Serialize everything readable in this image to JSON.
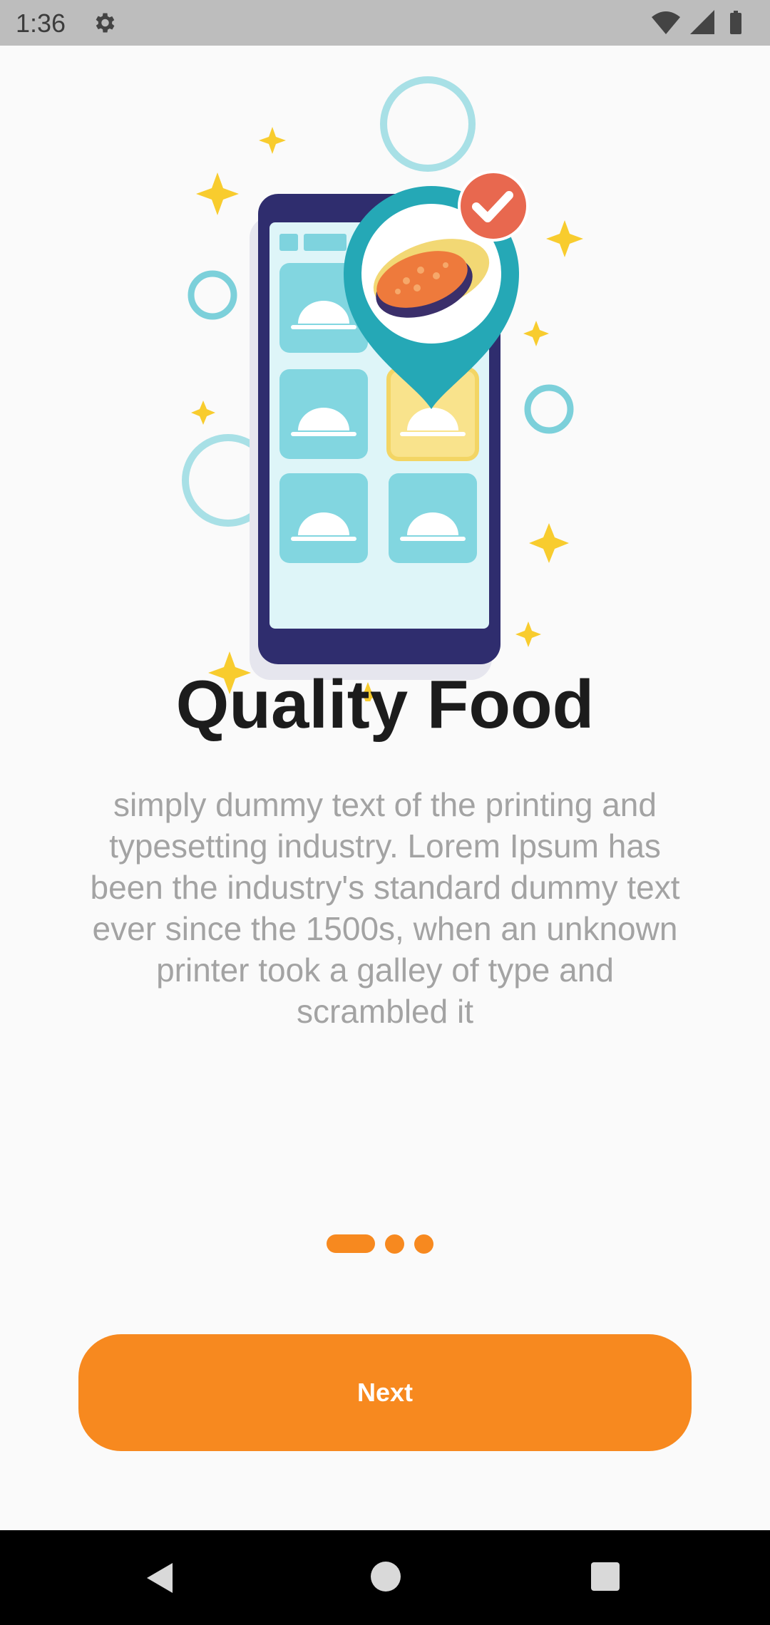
{
  "status_bar": {
    "time": "1:36",
    "icons": [
      "gear-icon",
      "wifi-icon",
      "signal-icon",
      "battery-icon"
    ]
  },
  "onboarding": {
    "illustration": "food-app-phone-illustration",
    "title": "Quality Food",
    "description": "simply dummy text of the printing and typesetting industry. Lorem Ipsum has been the industry's standard dummy text ever since the 1500s, when an unknown printer took a galley of type and scrambled it",
    "page_indicator": {
      "total": 3,
      "current": 1
    },
    "next_label": "Next"
  },
  "nav_bar": {
    "icons": [
      "back-icon",
      "home-icon",
      "recents-icon"
    ]
  },
  "colors": {
    "accent": "#f7891f",
    "status_bar": "#bdbdbd",
    "title": "#1c1c1c",
    "description": "#a3a3a3",
    "background": "#fafafa",
    "nav_bar": "#000000"
  }
}
